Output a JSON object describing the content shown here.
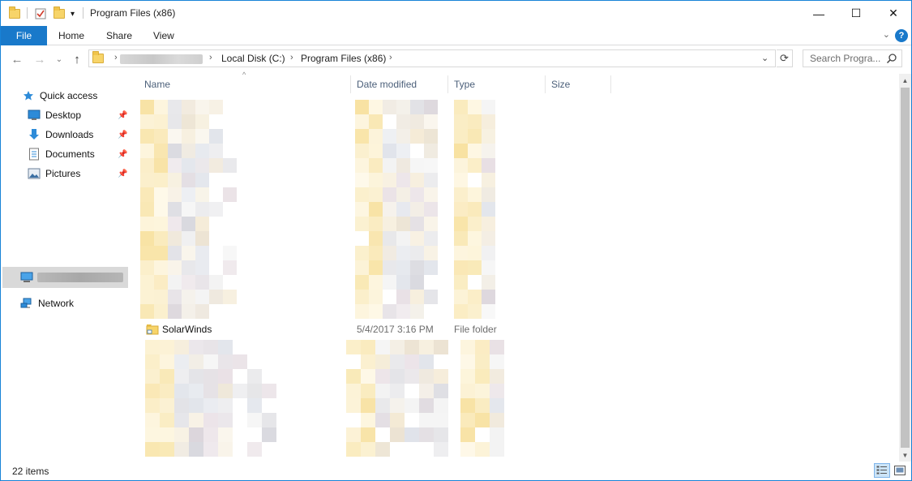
{
  "window": {
    "title": "Program Files (x86)",
    "minimize_glyph": "—",
    "maximize_glyph": "☐",
    "close_glyph": "✕",
    "quick_access_dropdown_glyph": "▾"
  },
  "ribbon": {
    "tabs": [
      "File",
      "Home",
      "Share",
      "View"
    ],
    "expand_glyph": "⌄",
    "help_glyph": "?"
  },
  "navigation": {
    "back_glyph": "←",
    "forward_glyph": "→",
    "recent_glyph": "⌄",
    "up_glyph": "↑",
    "breadcrumb": [
      "Local Disk (C:)",
      "Program Files (x86)"
    ],
    "chevron_glyph": "›",
    "address_dropdown_glyph": "⌄",
    "refresh_glyph": "⟳",
    "search_placeholder": "Search Progra..."
  },
  "nav_pane": {
    "quick_access": "Quick access",
    "items": [
      {
        "label": "Desktop",
        "icon": "desktop-icon",
        "pinned": true
      },
      {
        "label": "Downloads",
        "icon": "downloads-icon",
        "pinned": true
      },
      {
        "label": "Documents",
        "icon": "documents-icon",
        "pinned": true
      },
      {
        "label": "Pictures",
        "icon": "pictures-icon",
        "pinned": true
      }
    ],
    "pin_glyph": "📌",
    "this_pc_icon": "computer-icon",
    "network": "Network"
  },
  "file_list": {
    "columns": [
      "Name",
      "Date modified",
      "Type",
      "Size"
    ],
    "sort_glyph": "^",
    "visible_item": {
      "name": "SolarWinds",
      "date_modified": "5/4/2017 3:16 PM",
      "type": "File folder"
    }
  },
  "scrollbar": {
    "up_glyph": "▲",
    "down_glyph": "▼"
  },
  "status": {
    "item_count": "22 items"
  },
  "colors": {
    "accent": "#1979ca",
    "folder": "#f7d469",
    "selection": "#d9d9d9",
    "header_text": "#4c607a"
  }
}
